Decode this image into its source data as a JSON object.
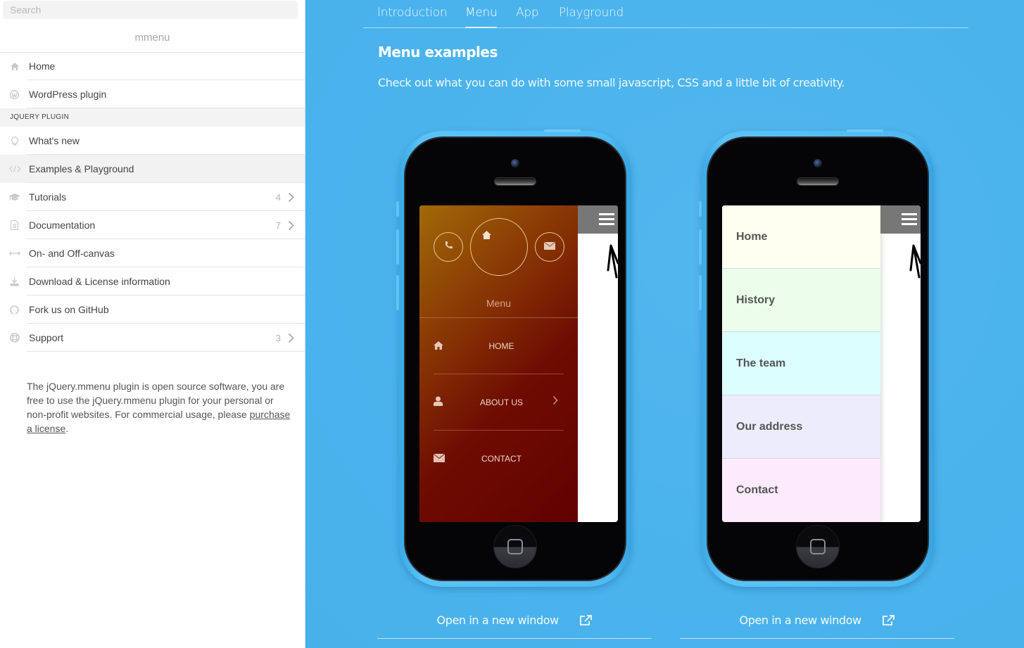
{
  "sidebar": {
    "search": {
      "placeholder": "Search",
      "value": ""
    },
    "brand": "mmenu",
    "items_top": [
      {
        "icon": "home-icon",
        "label": "Home"
      },
      {
        "icon": "wordpress-icon",
        "label": "WordPress plugin"
      }
    ],
    "section_label": "JQUERY PLUGIN",
    "items": [
      {
        "icon": "lightbulb-icon",
        "label": "What's new",
        "selected": false
      },
      {
        "icon": "code-icon",
        "label": "Examples & Playground",
        "selected": true
      },
      {
        "icon": "graduation-cap-icon",
        "label": "Tutorials",
        "count": "4",
        "has_submenu": true
      },
      {
        "icon": "document-icon",
        "label": "Documentation",
        "count": "7",
        "has_submenu": true
      },
      {
        "icon": "arrows-horizontal-icon",
        "label": "On- and Off-canvas"
      },
      {
        "icon": "download-icon",
        "label": "Download & License information"
      },
      {
        "icon": "github-icon",
        "label": "Fork us on GitHub"
      },
      {
        "icon": "lifebuoy-icon",
        "label": "Support",
        "count": "3",
        "has_submenu": true
      }
    ],
    "about": {
      "text": "The jQuery.mmenu plugin is open source software, you are free to use the jQuery.mmenu plugin for your personal or non-profit websites. For commercial usage, please ",
      "link_label": "purchase a license",
      "suffix": "."
    }
  },
  "main": {
    "tabs": [
      {
        "label": "Introduction",
        "active": false
      },
      {
        "label": "Menu",
        "active": true
      },
      {
        "label": "App",
        "active": false
      },
      {
        "label": "Playground",
        "active": false
      }
    ],
    "title": "Menu examples",
    "subtitle": "Check out what you can do with some small javascript, CSS and a little bit of creativity.",
    "examples": [
      {
        "menu_title": "Menu",
        "circle_icons": [
          "phone-icon",
          "home-icon",
          "envelope-icon"
        ],
        "items": [
          {
            "icon": "home-icon",
            "label": "HOME"
          },
          {
            "icon": "user-icon",
            "label": "ABOUT US",
            "has_submenu": true
          },
          {
            "icon": "envelope-icon",
            "label": "CONTACT"
          }
        ],
        "open_label": "Open in a new window"
      },
      {
        "items": [
          {
            "label": "Home",
            "color": "#fefff0"
          },
          {
            "label": "History",
            "color": "#ebfdeb"
          },
          {
            "label": "The team",
            "color": "#dcfefe"
          },
          {
            "label": "Our address",
            "color": "#ececfc"
          },
          {
            "label": "Contact",
            "color": "#fdebfd"
          }
        ],
        "open_label": "Open in a new window"
      }
    ]
  },
  "colors": {
    "page_background": "#4bb3ec",
    "phone_body": "#4fbaf2",
    "menu1_gradient_start": "#a06a08",
    "menu1_gradient_end": "#620000"
  }
}
